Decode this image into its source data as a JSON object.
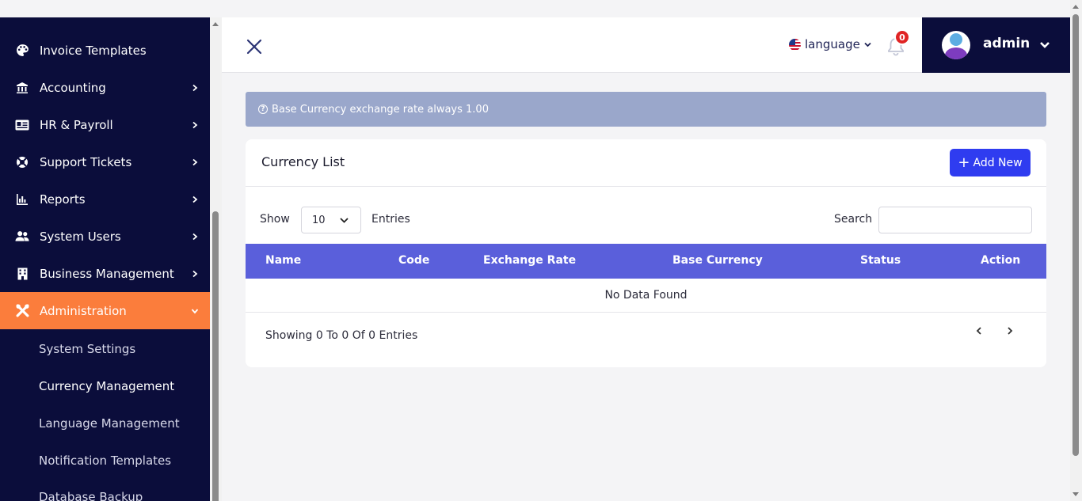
{
  "sidebar": {
    "items": [
      {
        "label": "Invoice Templates",
        "icon": "palette-icon"
      },
      {
        "label": "Accounting",
        "icon": "bank-icon"
      },
      {
        "label": "HR & Payroll",
        "icon": "id-card-icon"
      },
      {
        "label": "Support Tickets",
        "icon": "lifebuoy-icon"
      },
      {
        "label": "Reports",
        "icon": "bar-chart-icon"
      },
      {
        "label": "System Users",
        "icon": "users-icon"
      },
      {
        "label": "Business Management",
        "icon": "building-icon"
      },
      {
        "label": "Administration",
        "icon": "tools-icon"
      }
    ],
    "sub_items": [
      {
        "label": "System Settings"
      },
      {
        "label": "Currency Management"
      },
      {
        "label": "Language Management"
      },
      {
        "label": "Notification Templates"
      },
      {
        "label": "Database Backup"
      }
    ]
  },
  "header": {
    "language_label": "language",
    "notification_count": "0",
    "user_name": "admin"
  },
  "notice": {
    "text": "Base Currency exchange rate always 1.00"
  },
  "card": {
    "title": "Currency List",
    "add_label": "Add New",
    "show_label": "Show",
    "entries_value": "10",
    "entries_label": "Entries",
    "search_label": "Search",
    "search_value": "",
    "columns": [
      "Name",
      "Code",
      "Exchange Rate",
      "Base Currency",
      "Status",
      "Action"
    ],
    "empty_text": "No Data Found",
    "showing_text": "Showing 0 To 0 Of 0 Entries"
  },
  "colors": {
    "sidebar_bg": "#0b0d3b",
    "active_item": "#fb7d3c",
    "table_header": "#5a5fdb",
    "primary_button": "#2f3cf0",
    "notice_bg": "#9aa7cb",
    "badge": "#e02424"
  }
}
